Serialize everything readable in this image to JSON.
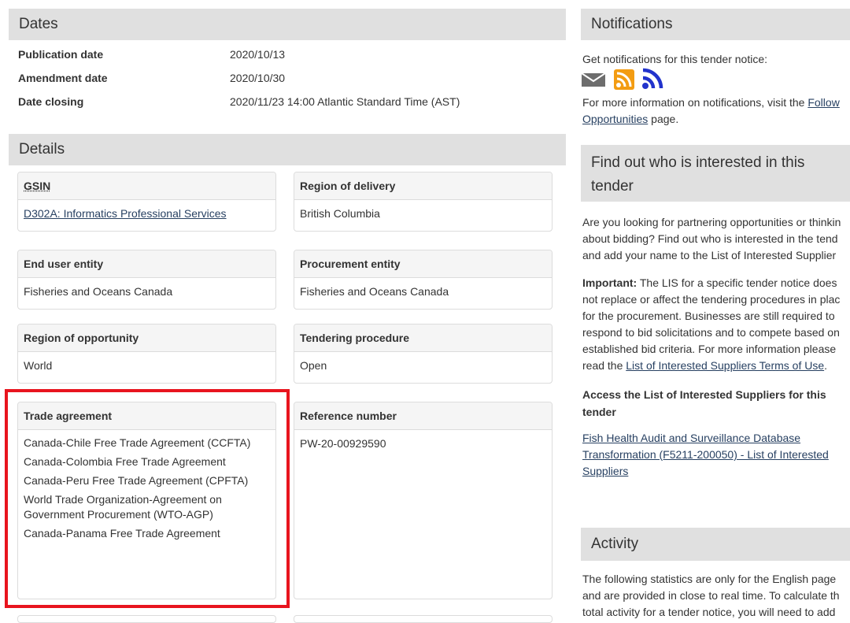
{
  "dates": {
    "title": "Dates",
    "publication_label": "Publication date",
    "publication_value": "2020/10/13",
    "amendment_label": "Amendment date",
    "amendment_value": "2020/10/30",
    "closing_label": "Date closing",
    "closing_value": "2020/11/23 14:00 Atlantic Standard Time (AST)"
  },
  "details": {
    "title": "Details",
    "gsin_label": "GSIN",
    "gsin_value": "D302A: Informatics Professional Services",
    "region_delivery_label": "Region of delivery",
    "region_delivery_value": "British Columbia",
    "end_user_label": "End user entity",
    "end_user_value": "Fisheries and Oceans Canada",
    "procurement_label": "Procurement entity",
    "procurement_value": "Fisheries and Oceans Canada",
    "region_opportunity_label": "Region of opportunity",
    "region_opportunity_value": "World",
    "tendering_label": "Tendering procedure",
    "tendering_value": "Open",
    "trade_label": "Trade agreement",
    "trade_items": [
      "Canada-Chile Free Trade Agreement (CCFTA)",
      "Canada-Colombia Free Trade Agreement",
      "Canada-Peru Free Trade Agreement (CPFTA)",
      "World Trade Organization-Agreement on Government Procurement (WTO-AGP)",
      "Canada-Panama Free Trade Agreement"
    ],
    "reference_label": "Reference number",
    "reference_value": "PW-20-00929590"
  },
  "notifications": {
    "title": "Notifications",
    "intro": "Get notifications for this tender notice:",
    "more_prefix": "For more information on notifications, visit the ",
    "more_link1": "Follow",
    "more_link2": "Opportunities",
    "more_suffix": " page."
  },
  "interested": {
    "title_line1": "Find out who is interested in this",
    "title_line2": "tender",
    "p1_l1": "Are you looking for partnering opportunities or thinkin",
    "p1_l2": "about bidding? Find out who is interested in the tend",
    "p1_l3": "and add your name to the List of Interested Supplier",
    "important_label": "Important:",
    "p2_l1": " The LIS for a specific tender notice does",
    "p2_l2": "not replace or affect the tendering procedures in plac",
    "p2_l3": "for the procurement. Businesses are still required to",
    "p2_l4": "respond to bid solicitations and to compete based on",
    "p2_l5": "established bid criteria. For more information please",
    "p2_l6_prefix": "read the ",
    "p2_l6_link": "List of Interested Suppliers Terms of Use",
    "p2_l6_suffix": ".",
    "access_l1": "Access the List of Interested Suppliers for this",
    "access_l2": "tender",
    "link_l1": "Fish Health Audit and Surveillance Database",
    "link_l2": "Transformation (F5211-200050) - List of Interested",
    "link_l3": "Suppliers"
  },
  "activity": {
    "title": "Activity",
    "l1": "The following statistics are only for the English page",
    "l2": "and are provided in close to real time. To calculate th",
    "l3": "total activity for a tender notice, you will need to add"
  },
  "colors": {
    "header_bg": "#e0e0e0",
    "link": "#284162",
    "highlight": "#e8141e",
    "rss": "#f39c12",
    "feed": "#2233cc"
  }
}
